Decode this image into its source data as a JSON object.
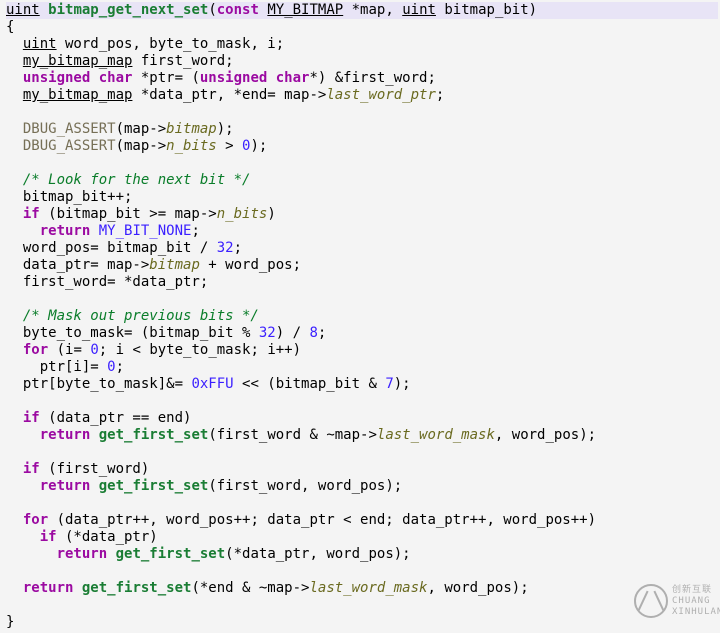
{
  "code": {
    "lines": [
      [
        [
          "kw",
          "uint"
        ],
        [
          "plain",
          " "
        ],
        [
          "fn",
          "bitmap_get_next_set"
        ],
        [
          "plain",
          "("
        ],
        [
          "type",
          "const"
        ],
        [
          "plain",
          " "
        ],
        [
          "kw",
          "MY_BITMAP"
        ],
        [
          "plain",
          " *map, "
        ],
        [
          "kw",
          "uint"
        ],
        [
          "plain",
          " bitmap_bit)"
        ]
      ],
      [
        [
          "plain",
          "{"
        ]
      ],
      [
        [
          "plain",
          "  "
        ],
        [
          "kw",
          "uint"
        ],
        [
          "plain",
          " word_pos, byte_to_mask, i;"
        ]
      ],
      [
        [
          "plain",
          "  "
        ],
        [
          "kw",
          "my_bitmap_map"
        ],
        [
          "plain",
          " first_word;"
        ]
      ],
      [
        [
          "plain",
          "  "
        ],
        [
          "type",
          "unsigned char"
        ],
        [
          "plain",
          " *ptr= ("
        ],
        [
          "type",
          "unsigned char"
        ],
        [
          "plain",
          "*) &first_word;"
        ]
      ],
      [
        [
          "plain",
          "  "
        ],
        [
          "kw",
          "my_bitmap_map"
        ],
        [
          "plain",
          " *data_ptr, *end= map->"
        ],
        [
          "field",
          "last_word_ptr"
        ],
        [
          "plain",
          ";"
        ]
      ],
      [
        [
          "plain",
          " "
        ]
      ],
      [
        [
          "plain",
          "  "
        ],
        [
          "macro",
          "DBUG_ASSERT"
        ],
        [
          "plain",
          "(map->"
        ],
        [
          "field",
          "bitmap"
        ],
        [
          "plain",
          ");"
        ]
      ],
      [
        [
          "plain",
          "  "
        ],
        [
          "macro",
          "DBUG_ASSERT"
        ],
        [
          "plain",
          "(map->"
        ],
        [
          "field",
          "n_bits"
        ],
        [
          "plain",
          " > "
        ],
        [
          "const",
          "0"
        ],
        [
          "plain",
          ");"
        ]
      ],
      [
        [
          "plain",
          " "
        ]
      ],
      [
        [
          "plain",
          "  "
        ],
        [
          "cmt",
          "/* Look for the next bit */"
        ]
      ],
      [
        [
          "plain",
          "  bitmap_bit++;"
        ]
      ],
      [
        [
          "plain",
          "  "
        ],
        [
          "type",
          "if"
        ],
        [
          "plain",
          " (bitmap_bit >= map->"
        ],
        [
          "field",
          "n_bits"
        ],
        [
          "plain",
          ")"
        ]
      ],
      [
        [
          "plain",
          "    "
        ],
        [
          "type",
          "return"
        ],
        [
          "plain",
          " "
        ],
        [
          "const",
          "MY_BIT_NONE"
        ],
        [
          "plain",
          ";"
        ]
      ],
      [
        [
          "plain",
          "  word_pos= bitmap_bit / "
        ],
        [
          "const",
          "32"
        ],
        [
          "plain",
          ";"
        ]
      ],
      [
        [
          "plain",
          "  data_ptr= map->"
        ],
        [
          "field",
          "bitmap"
        ],
        [
          "plain",
          " + word_pos;"
        ]
      ],
      [
        [
          "plain",
          "  first_word= *data_ptr;"
        ]
      ],
      [
        [
          "plain",
          " "
        ]
      ],
      [
        [
          "plain",
          "  "
        ],
        [
          "cmt",
          "/* Mask out previous bits */"
        ]
      ],
      [
        [
          "plain",
          "  byte_to_mask= (bitmap_bit % "
        ],
        [
          "const",
          "32"
        ],
        [
          "plain",
          ") / "
        ],
        [
          "const",
          "8"
        ],
        [
          "plain",
          ";"
        ]
      ],
      [
        [
          "plain",
          "  "
        ],
        [
          "type",
          "for"
        ],
        [
          "plain",
          " (i= "
        ],
        [
          "const",
          "0"
        ],
        [
          "plain",
          "; i < byte_to_mask; i++)"
        ]
      ],
      [
        [
          "plain",
          "    ptr[i]= "
        ],
        [
          "const",
          "0"
        ],
        [
          "plain",
          ";"
        ]
      ],
      [
        [
          "plain",
          "  ptr[byte_to_mask]&= "
        ],
        [
          "const",
          "0xFFU"
        ],
        [
          "plain",
          " << (bitmap_bit & "
        ],
        [
          "const",
          "7"
        ],
        [
          "plain",
          ");"
        ]
      ],
      [
        [
          "plain",
          " "
        ]
      ],
      [
        [
          "plain",
          "  "
        ],
        [
          "type",
          "if"
        ],
        [
          "plain",
          " (data_ptr == end)"
        ]
      ],
      [
        [
          "plain",
          "    "
        ],
        [
          "type",
          "return"
        ],
        [
          "plain",
          " "
        ],
        [
          "fn",
          "get_first_set"
        ],
        [
          "plain",
          "(first_word & ~map->"
        ],
        [
          "field",
          "last_word_mask"
        ],
        [
          "plain",
          ", word_pos);"
        ]
      ],
      [
        [
          "plain",
          " "
        ]
      ],
      [
        [
          "plain",
          "  "
        ],
        [
          "type",
          "if"
        ],
        [
          "plain",
          " (first_word)"
        ]
      ],
      [
        [
          "plain",
          "    "
        ],
        [
          "type",
          "return"
        ],
        [
          "plain",
          " "
        ],
        [
          "fn",
          "get_first_set"
        ],
        [
          "plain",
          "(first_word, word_pos);"
        ]
      ],
      [
        [
          "plain",
          " "
        ]
      ],
      [
        [
          "plain",
          "  "
        ],
        [
          "type",
          "for"
        ],
        [
          "plain",
          " (data_ptr++, word_pos++; data_ptr < end; data_ptr++, word_pos++)"
        ]
      ],
      [
        [
          "plain",
          "    "
        ],
        [
          "type",
          "if"
        ],
        [
          "plain",
          " (*data_ptr)"
        ]
      ],
      [
        [
          "plain",
          "      "
        ],
        [
          "type",
          "return"
        ],
        [
          "plain",
          " "
        ],
        [
          "fn",
          "get_first_set"
        ],
        [
          "plain",
          "(*data_ptr, word_pos);"
        ]
      ],
      [
        [
          "plain",
          " "
        ]
      ],
      [
        [
          "plain",
          "  "
        ],
        [
          "type",
          "return"
        ],
        [
          "plain",
          " "
        ],
        [
          "fn",
          "get_first_set"
        ],
        [
          "plain",
          "(*end & ~map->"
        ],
        [
          "field",
          "last_word_mask"
        ],
        [
          "plain",
          ", word_pos);"
        ]
      ],
      [
        [
          "plain",
          " "
        ]
      ],
      [
        [
          "plain",
          "}"
        ]
      ]
    ],
    "highlighted_line_index": 0
  },
  "watermark": {
    "line1": "创新互联",
    "line2": "CHUANG XINHULAN"
  }
}
